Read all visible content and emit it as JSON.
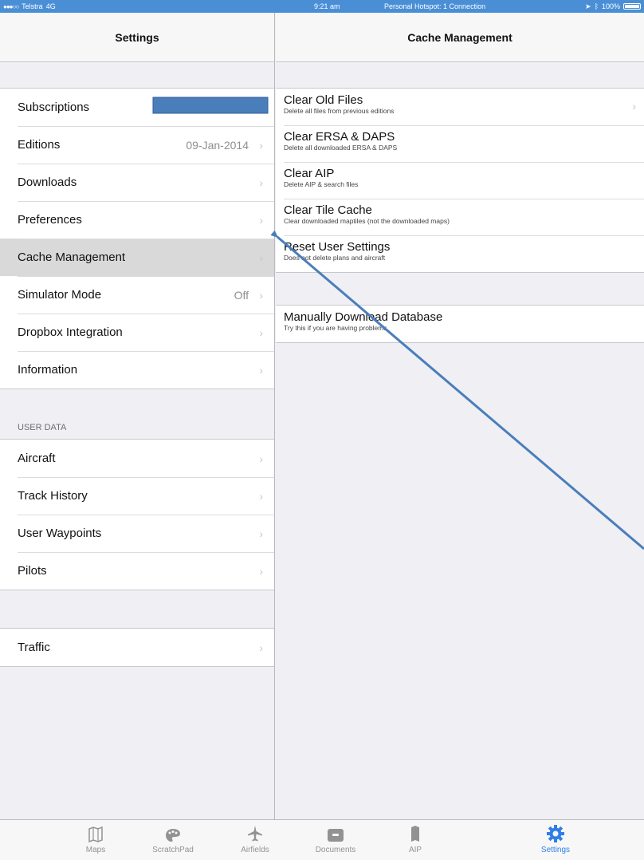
{
  "statusbar": {
    "carrier": "Telstra",
    "network": "4G",
    "time": "9:21 am",
    "hotspot": "Personal Hotspot: 1 Connection",
    "battery": "100%"
  },
  "master": {
    "title": "Settings",
    "group1": [
      {
        "label": "Subscriptions",
        "detail": "",
        "chevron": false
      },
      {
        "label": "Editions",
        "detail": "09-Jan-2014",
        "chevron": true
      },
      {
        "label": "Downloads",
        "detail": "",
        "chevron": true
      },
      {
        "label": "Preferences",
        "detail": "",
        "chevron": true
      },
      {
        "label": "Cache Management",
        "detail": "",
        "chevron": true
      },
      {
        "label": "Simulator Mode",
        "detail": "Off",
        "chevron": true
      },
      {
        "label": "Dropbox Integration",
        "detail": "",
        "chevron": true
      },
      {
        "label": "Information",
        "detail": "",
        "chevron": true
      }
    ],
    "user_data_header": "USER DATA",
    "group2": [
      {
        "label": "Aircraft",
        "chevron": true
      },
      {
        "label": "Track History",
        "chevron": true
      },
      {
        "label": "User Waypoints",
        "chevron": true
      },
      {
        "label": "Pilots",
        "chevron": true
      }
    ],
    "group3": [
      {
        "label": "Traffic",
        "chevron": true
      }
    ]
  },
  "detail": {
    "title": "Cache Management",
    "group1": [
      {
        "title": "Clear Old Files",
        "subtitle": "Delete all files from previous editions",
        "chevron": true
      },
      {
        "title": "Clear ERSA & DAPS",
        "subtitle": "Delete all downloaded ERSA & DAPS",
        "chevron": false
      },
      {
        "title": "Clear AIP",
        "subtitle": "Delete AIP & search files",
        "chevron": false
      },
      {
        "title": "Clear Tile Cache",
        "subtitle": "Clear downloaded maptiles (not the downloaded maps)",
        "chevron": false
      },
      {
        "title": "Reset User Settings",
        "subtitle": "Does not delete plans and aircraft",
        "chevron": false
      }
    ],
    "group2": [
      {
        "title": "Manually Download Database",
        "subtitle": "Try this if you are having problems",
        "chevron": false
      }
    ]
  },
  "tabs": [
    {
      "label": "Maps",
      "icon": "map-icon",
      "active": false
    },
    {
      "label": "ScratchPad",
      "icon": "palette-icon",
      "active": false
    },
    {
      "label": "Airfields",
      "icon": "airplane-icon",
      "active": false
    },
    {
      "label": "Documents",
      "icon": "box-icon",
      "active": false
    },
    {
      "label": "AIP",
      "icon": "book-icon",
      "active": false
    },
    {
      "label": "Settings",
      "icon": "gear-icon",
      "active": true
    }
  ],
  "colors": {
    "accent": "#2f7ee8",
    "statusbar": "#4a8fd6",
    "annotation": "#4a7ebb"
  }
}
